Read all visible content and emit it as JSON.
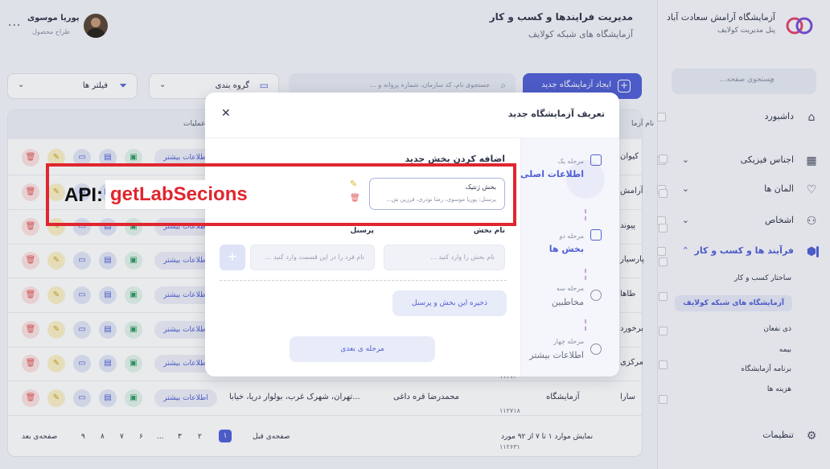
{
  "brand": {
    "title": "آزمایشگاه آرامش سعادت آباد",
    "subtitle": "پنل مدیریت کولایف"
  },
  "header": {
    "title": "مدیریت فرایندها و کسب و کار",
    "subtitle": "آزمایشگاه های شبکه کولایف"
  },
  "user": {
    "name": "پوریا موسوی",
    "role": "طراح محصول",
    "menu": "..."
  },
  "sidebar": {
    "search_placeholder": "جستجوی صفحه...",
    "items": [
      {
        "label": "داشبورد",
        "icon": "home-icon"
      },
      {
        "label": "اجناس فیزیکی",
        "icon": "grid-icon"
      },
      {
        "label": "المان ها",
        "icon": "heart-icon"
      },
      {
        "label": "اشخاص",
        "icon": "people-icon"
      },
      {
        "label": "فرآیند ها و کسب و کار",
        "icon": "box-icon"
      }
    ],
    "subitems": [
      "ساختار کسب و کار",
      "آزمایشگاه های شبکه کولایف",
      "ذی نفعان",
      "بیمه",
      "برنامه آزمایشگاه",
      "هزینه ها"
    ],
    "settings": "تنظیمات"
  },
  "toolbar": {
    "new_button": "ایجاد آزمایشگاه جدید",
    "search_placeholder": "جستجوی نام، کد سازمان، شماره پروانه و ...",
    "group_by": "گروه بندی",
    "filters": "فیلتر ها"
  },
  "table": {
    "headers": {
      "name": "نام آزما",
      "actions": "عملیات"
    },
    "more_label": "اطلاعات بیشتر",
    "rows": [
      {
        "name": "کیوان"
      },
      {
        "name": "آرامش"
      },
      {
        "name": "پیوند"
      },
      {
        "name": "پارسیار"
      },
      {
        "name": "طاها"
      },
      {
        "name": "برخورد"
      },
      {
        "name": "مرکزی",
        "code": "۱۱۲۷۲۰"
      },
      {
        "name": "سارا",
        "type": "آزمایشگاه",
        "manager": "محمدرضا قره داغی",
        "address": "تهران، شهرک غرب، بولوار دریا، خیابا...",
        "code": "۱۱۲۷۱۸"
      }
    ],
    "footer_code": "۱۱۲۶۳۱"
  },
  "pagination": {
    "summary": "نمایش موارد ۱ تا ۷ از ۹۲ مورد",
    "prev": "صفحه‌ی قبل",
    "next": "صفحه‌ی بعد",
    "current": "۱",
    "pages": [
      "۲",
      "۳",
      "...",
      "۶",
      "۷",
      "۸",
      "۹"
    ]
  },
  "modal": {
    "title": "تعریف آزمایشگاه جدید",
    "close": "✕",
    "steps": [
      {
        "kicker": "مرحله یک",
        "title": "اطلاعات اصلی"
      },
      {
        "kicker": "مرحله دو",
        "title": "بخش ها"
      },
      {
        "kicker": "مرحله سه",
        "title": "مخاطبین"
      },
      {
        "kicker": "مرحله چهار",
        "title": "اطلاعات بیشتر"
      }
    ],
    "section_title": "اضافه کردن بخش جدید",
    "card": {
      "title": "بخش ژنتیک",
      "detail": "پرسنل: پوریا موسوی، رضا نوذری، فرزین ش..."
    },
    "fields": {
      "section_label": "نام بخش",
      "section_placeholder": "نام بخش را وارد کنید ...",
      "staff_label": "پرسنل",
      "staff_placeholder": "نام فرد را در این قسمت وارد کنید ..."
    },
    "save_button": "ذخیره این بخش و پرسنل",
    "next_button": "مرحله ی بعدی"
  },
  "annotation": {
    "prefix": "API:",
    "function": "getLabSecions",
    "color": "#e0262e"
  },
  "colors": {
    "accent": "#5160d6",
    "danger": "#e05a5a",
    "warning": "#d6b31f"
  }
}
